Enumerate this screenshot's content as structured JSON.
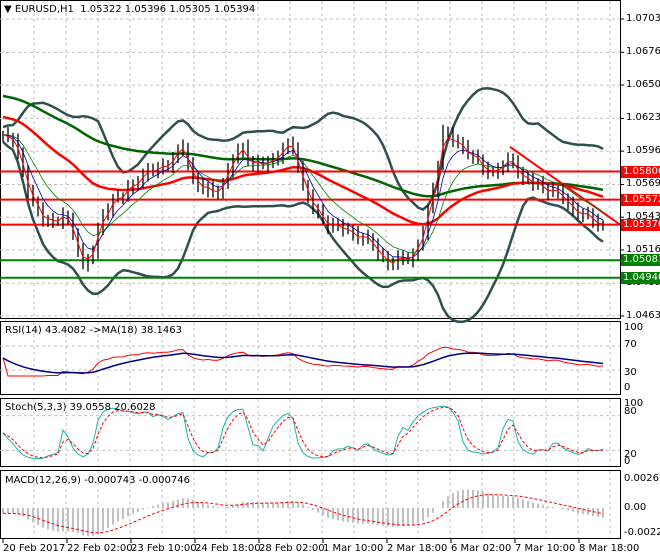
{
  "header": {
    "symbol": "EURUSD,H1",
    "ohlc": "1.05322 1.05396 1.05305 1.05394"
  },
  "indicators": {
    "rsi_label": "RSI(14) 43.4082  ->MA(18) 38.1463",
    "stoch_label": "Stoch(5,3,3) 39.0558 20.6028",
    "macd_label": "MACD(12,26,9) -0.000743 -0.000746"
  },
  "price_axis": [
    "1.07035",
    "1.06765",
    "1.06500",
    "1.06230",
    "1.05965",
    "1.05695",
    "1.05430",
    "1.05165",
    "1.04895",
    "1.04630"
  ],
  "levels": [
    {
      "price": "1.05800",
      "color": "#ff0000"
    },
    {
      "price": "1.05572",
      "color": "#ff0000"
    },
    {
      "price": "1.05370",
      "color": "#ff0000"
    },
    {
      "price": "1.05081",
      "color": "#008000"
    },
    {
      "price": "1.04940",
      "color": "#008000"
    }
  ],
  "current_price": 1.05394,
  "rsi_axis": [
    "100",
    "70",
    "30",
    "0"
  ],
  "stoch_axis": [
    "100",
    "80",
    "20",
    "0"
  ],
  "macd_axis": [
    "0.00262",
    "0.00",
    "-0.002274"
  ],
  "time_axis": [
    "20 Feb 2017",
    "22 Feb 02:00",
    "23 Feb 10:00",
    "24 Feb 18:00",
    "28 Feb 02:00",
    "1 Mar 10:00",
    "2 Mar 18:00",
    "6 Mar 02:00",
    "7 Mar 10:00",
    "8 Mar 18:00"
  ],
  "chart_data": {
    "type": "candlestick-ohlc",
    "title": "EURUSD,H1",
    "ylim": [
      1.0463,
      1.07035
    ],
    "closes": [
      1.061,
      1.0605,
      1.058,
      1.0555,
      1.054,
      1.054,
      1.0545,
      1.053,
      1.0505,
      1.0515,
      1.0545,
      1.0558,
      1.056,
      1.057,
      1.0578,
      1.058,
      1.0585,
      1.059,
      1.06,
      1.0575,
      1.0565,
      1.0563,
      1.057,
      1.059,
      1.06,
      1.0585,
      1.0585,
      1.059,
      1.0598,
      1.06,
      1.057,
      1.055,
      1.054,
      1.0537,
      1.0533,
      1.053,
      1.0527,
      1.052,
      1.051,
      1.0505,
      1.051,
      1.0512,
      1.053,
      1.0565,
      1.0612,
      1.0605,
      1.06,
      1.0592,
      1.0582,
      1.058,
      1.0585,
      1.0588,
      1.0575,
      1.057,
      1.0567,
      1.0565,
      1.0558,
      1.055,
      1.0545,
      1.054,
      1.0537
    ],
    "trendline": {
      "from": 1.06,
      "to": 1.0537
    },
    "colors": {
      "bars": "#000000",
      "ma_slow": "#006400",
      "ma_mid": "#ff0000",
      "bands": "#2f4f4f",
      "rsi": "#ff0000",
      "rsi_ma": "#000080",
      "stoch_main": "#20b2aa",
      "stoch_signal": "#ff0000",
      "macd_hist": "#c0c0c0",
      "macd_signal": "#ff0000"
    }
  }
}
